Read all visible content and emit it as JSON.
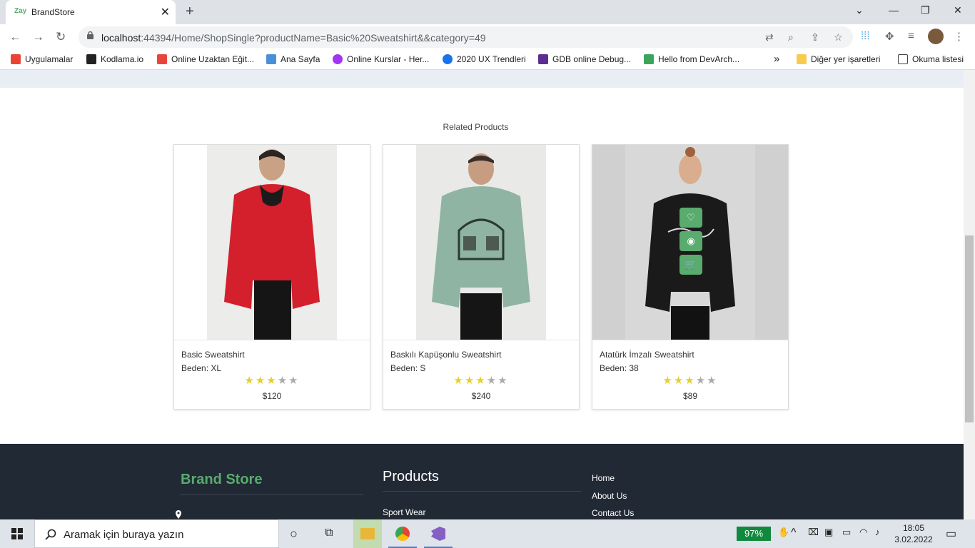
{
  "browser": {
    "tab_favicon": "Zay",
    "tab_title": "BrandStore",
    "tab_close": "✕",
    "new_tab": "+",
    "url_host": "localhost",
    "url_rest": ":44394/Home/ShopSingle?productName=Basic%20Sweatshirt&&category=49",
    "bookmarks": [
      {
        "label": "Uygulamalar",
        "color": "#ea4335"
      },
      {
        "label": "Kodlama.io",
        "color": "#222222"
      },
      {
        "label": "Online Uzaktan Eğit...",
        "color": "#e8453c"
      },
      {
        "label": "Ana Sayfa",
        "color": "#4a90d9"
      },
      {
        "label": "Online Kurslar - Her...",
        "color": "#a435f0"
      },
      {
        "label": "2020 UX Trendleri",
        "color": "#1a73e8"
      },
      {
        "label": "GDB online Debug...",
        "color": "#5b2e91"
      },
      {
        "label": "Hello from DevArch...",
        "color": "#3ba55c"
      }
    ],
    "more": "»",
    "other_bookmarks": "Diğer yer işaretleri",
    "reading_list": "Okuma listesi"
  },
  "main": {
    "related_title": "Related Products",
    "products": [
      {
        "name": "Basic Sweatshirt",
        "size": "Beden: XL",
        "rating": 3,
        "price": "$120",
        "color": "#d41f2c",
        "bg": "#ececea"
      },
      {
        "name": "Baskılı Kapüşonlu Sweatshirt",
        "size": "Beden: S",
        "rating": 3,
        "price": "$240",
        "color": "#8fb4a3",
        "bg": "#e9e9e7"
      },
      {
        "name": "Atatürk İmzalı Sweatshirt",
        "size": "Beden: 38",
        "rating": 3,
        "price": "$89",
        "color": "#1a1a1a",
        "bg": "#d8d8d8"
      }
    ],
    "stars": "★"
  },
  "footer": {
    "brand": "Brand Store",
    "products_title": "Products",
    "products_links": [
      "Sport Wear"
    ],
    "nav_links": [
      "Home",
      "About Us",
      "Contact Us"
    ]
  },
  "taskbar": {
    "search_placeholder": "Aramak için buraya yazın",
    "battery": "97%",
    "time": "18:05",
    "date": "3.02.2022"
  },
  "colors": {
    "accent": "#59ab6e",
    "footer_bg": "#212934"
  }
}
